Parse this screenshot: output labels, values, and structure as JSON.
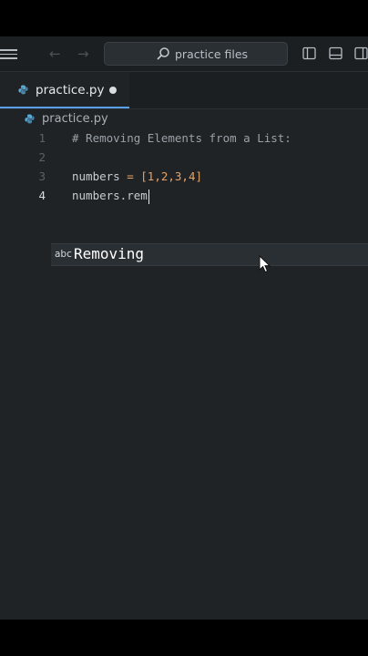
{
  "search": {
    "text": "practice files"
  },
  "tab": {
    "label": "practice.py",
    "unsaved": true
  },
  "breadcrumb": {
    "label": "practice.py"
  },
  "editor": {
    "lines": [
      {
        "number": "1",
        "text": "# Removing Elements from a List:"
      },
      {
        "number": "2",
        "text": ""
      },
      {
        "number": "3",
        "var": "numbers",
        "op": " = ",
        "value": "[1,2,3,4]"
      },
      {
        "number": "4",
        "text": "numbers.rem",
        "active": true
      }
    ]
  },
  "autocomplete": {
    "kind": "abc",
    "suggestion": "Removing"
  },
  "colors": {
    "background": "#1f2326",
    "titlebar": "#1b1f22",
    "accent": "#5aa0f0",
    "python_icon": "#5aa9d6",
    "number_literal": "#e5a36a"
  },
  "icons": [
    "menu-icon",
    "back-arrow-icon",
    "forward-arrow-icon",
    "search-icon",
    "toggle-sidebar-icon",
    "toggle-panel-icon",
    "split-editor-icon",
    "python-file-icon",
    "abc-text-icon",
    "mouse-pointer-icon"
  ]
}
